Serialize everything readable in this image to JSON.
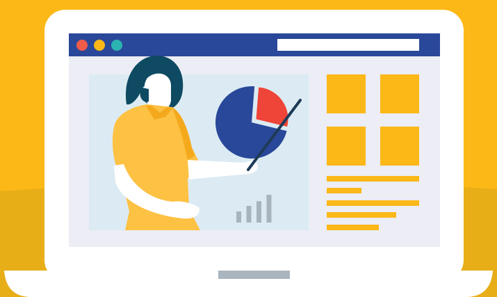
{
  "colors": {
    "background": "#FBB817",
    "floor": "#E7AE18",
    "laptop_frame": "#FFFFFF",
    "browser_bar": "#2A4899",
    "browser_body": "#ECEDF5",
    "slide_panel": "#DCEBF3",
    "dot_red": "#F15B4A",
    "dot_yellow": "#FBB817",
    "dot_teal": "#2BB3B1",
    "tile": "#FBB817",
    "pie_main": "#2A4899",
    "pie_slice": "#EF4438",
    "hair": "#0E4A62",
    "shirt": "#FDC143",
    "skin": "#FFFFFF",
    "pointer": "#1D3B57",
    "bars": "#A7B3BD",
    "hinge": "#A9B6BF"
  },
  "scene": {
    "icons": [
      "laptop-icon",
      "presenter-icon",
      "pie-chart-icon",
      "bar-chart-icon",
      "pointer-stick-icon"
    ],
    "mini_bar_levels": [
      0.4,
      0.6,
      0.77,
      1.0
    ],
    "pie_highlight_share": 0.22,
    "tile_count": 4,
    "text_line_count": 5
  }
}
